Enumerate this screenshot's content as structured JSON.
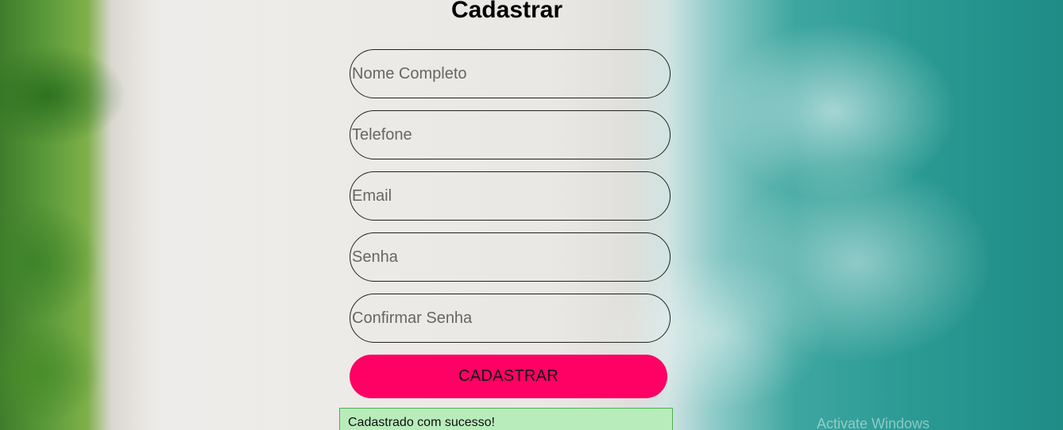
{
  "form": {
    "title": "Cadastrar",
    "fields": [
      {
        "placeholder": "Nome Completo",
        "value": ""
      },
      {
        "placeholder": "Telefone",
        "value": ""
      },
      {
        "placeholder": "Email",
        "value": ""
      },
      {
        "placeholder": "Senha",
        "value": ""
      },
      {
        "placeholder": "Confirmar Senha",
        "value": ""
      }
    ],
    "submit_label": "CADASTRAR",
    "success_message": "Cadastrado com sucesso!"
  },
  "colors": {
    "submit_bg": "#ff0064",
    "success_bg": "#b8ecba",
    "success_border": "#4caf50"
  },
  "os_watermark": "Activate Windows"
}
